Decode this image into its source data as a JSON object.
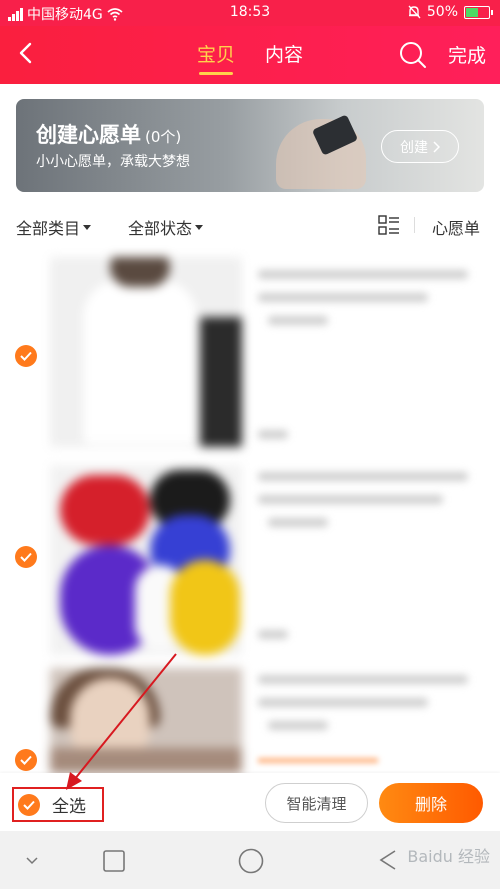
{
  "status_bar": {
    "carrier": "中国移动4G",
    "time": "18:53",
    "battery": "50%",
    "battery_level": 0.5
  },
  "nav": {
    "tabs": [
      {
        "label": "宝贝",
        "active": true
      },
      {
        "label": "内容",
        "active": false
      }
    ],
    "done_label": "完成"
  },
  "banner": {
    "title": "创建心愿单",
    "count": "(0个)",
    "subtitle": "小小心愿单，承载大梦想",
    "button_label": "创建"
  },
  "filters": {
    "category": "全部类目",
    "status": "全部状态",
    "wishlist": "心愿单"
  },
  "bottom_bar": {
    "select_all": "全选",
    "smart_clean": "智能清理",
    "delete": "删除"
  },
  "colors": {
    "brand_red": "#f8204a",
    "accent_orange": "#ff7a1c",
    "active_tab": "#ffd24c"
  },
  "watermark": "Baidu 经验"
}
